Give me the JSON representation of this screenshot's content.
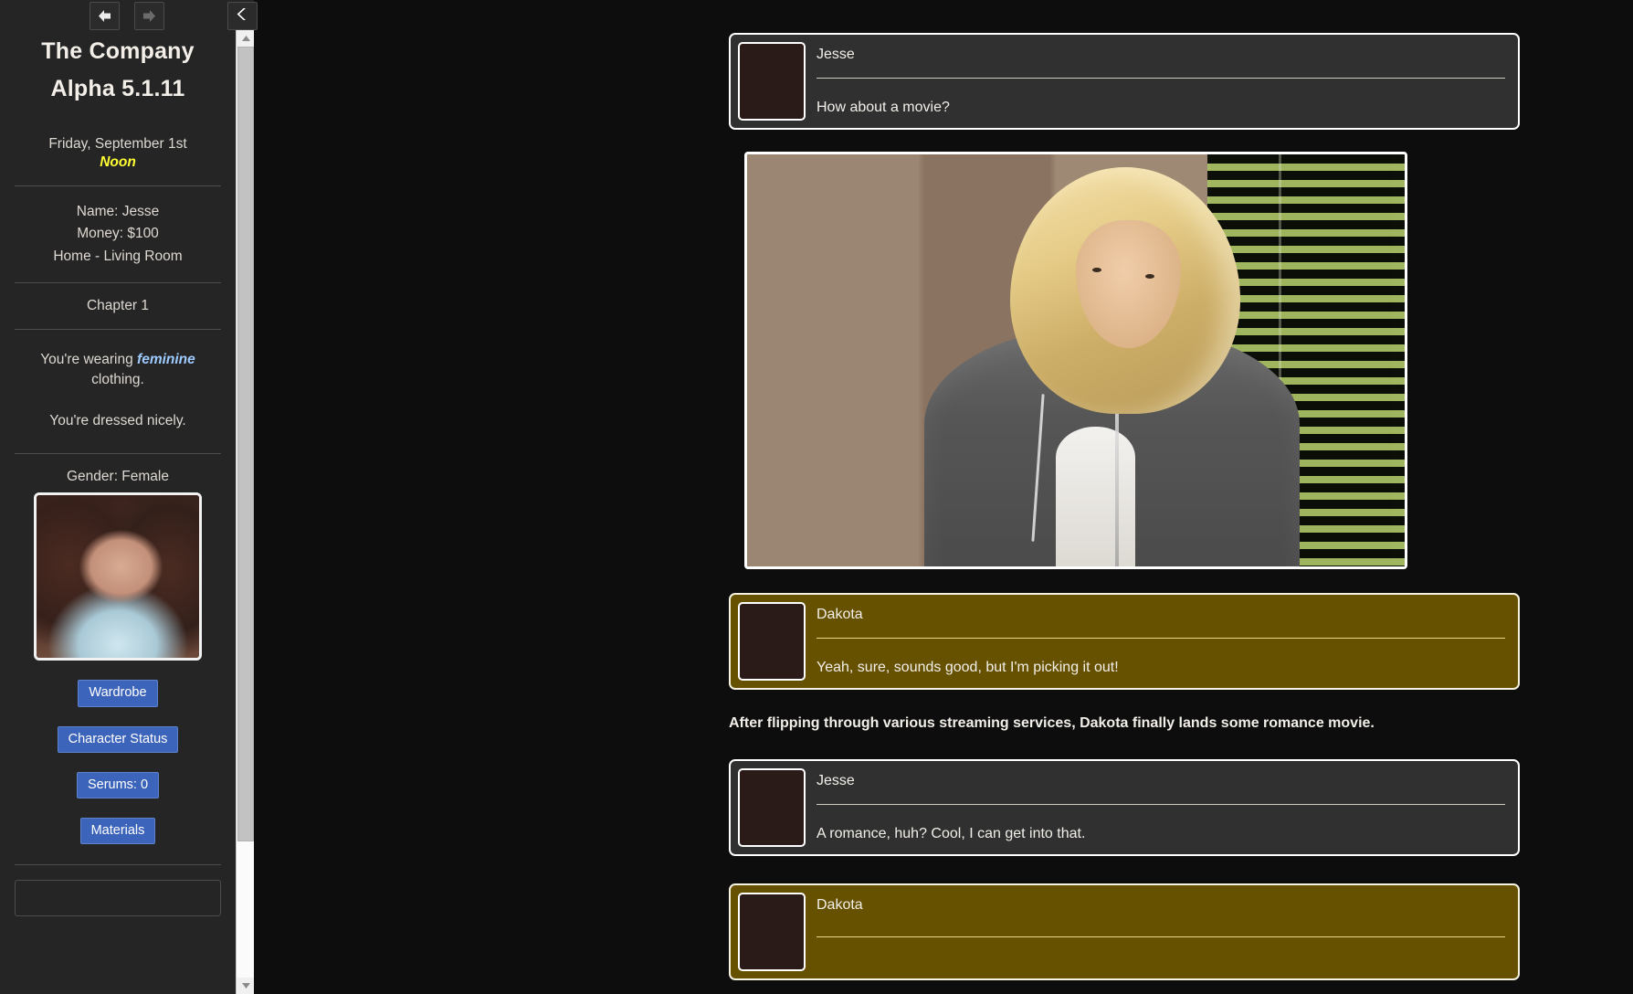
{
  "nav": {
    "back_label": "Back",
    "forward_label": "Forward",
    "collapse_label": "Collapse sidebar",
    "back_icon": "arrow-left-icon",
    "forward_icon": "arrow-right-icon",
    "collapse_icon": "chevron-left-icon"
  },
  "sidebar": {
    "title_line1": "The Company",
    "title_line2": "Alpha 5.1.11",
    "date": "Friday, September 1st",
    "time_of_day": "Noon",
    "name_line": "Name: Jesse",
    "money_line": "Money: $100",
    "location_line": "Home - Living Room",
    "chapter": "Chapter 1",
    "clothing_prefix": "You're wearing ",
    "clothing_style": "feminine",
    "clothing_suffix": " clothing.",
    "dressed_status": "You're dressed nicely.",
    "gender": "Gender: Female",
    "portrait_alt": "jesse-portrait",
    "buttons": [
      {
        "label": "Wardrobe"
      },
      {
        "label": "Character Status"
      },
      {
        "label": "Serums: 0"
      },
      {
        "label": "Materials"
      }
    ]
  },
  "colors": {
    "background": "#0d0d0d",
    "sidebar_bg": "#252525",
    "accent_button": "#3c64ba",
    "time_highlight": "#ffff33",
    "clothing_highlight": "#9ecbff",
    "dakota_bubble": "#665100",
    "jesse_bubble": "#303030"
  },
  "main": {
    "entries": [
      {
        "type": "message",
        "speaker": "Jesse",
        "text": "How about a movie?",
        "style": "jesse",
        "avatar": "jesse-avatar"
      },
      {
        "type": "image",
        "alt": "dakota-scene-photo"
      },
      {
        "type": "message",
        "speaker": "Dakota",
        "text": "Yeah, sure, sounds good, but I'm picking it out!",
        "style": "dakota",
        "avatar": "dakota-avatar"
      },
      {
        "type": "narration",
        "text": "After flipping through various streaming services, Dakota finally lands some romance movie."
      },
      {
        "type": "message",
        "speaker": "Jesse",
        "text": "A romance, huh? Cool, I can get into that.",
        "style": "jesse",
        "avatar": "jesse-avatar"
      },
      {
        "type": "message",
        "speaker": "Dakota",
        "text": "",
        "style": "dakota",
        "avatar": "dakota-avatar"
      }
    ]
  }
}
